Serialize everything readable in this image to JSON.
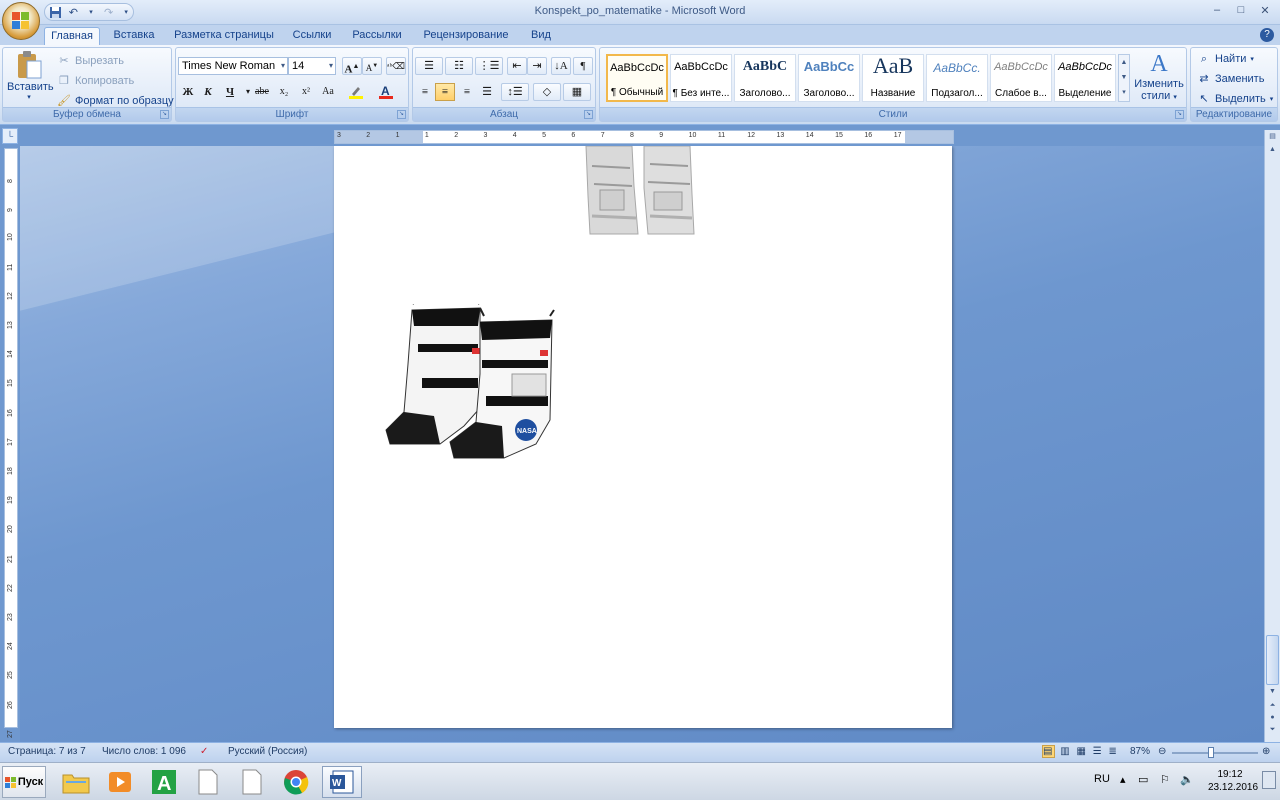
{
  "window": {
    "title": "Konspekt_po_matematike - Microsoft Word",
    "controls": [
      "–",
      "□",
      "✕"
    ]
  },
  "tabs": [
    "Главная",
    "Вставка",
    "Разметка страницы",
    "Ссылки",
    "Рассылки",
    "Рецензирование",
    "Вид"
  ],
  "clipboard": {
    "paste_label": "Вставить",
    "cut_label": "Вырезать",
    "copy_label": "Копировать",
    "format_painter_label": "Формат по образцу",
    "group_label": "Буфер обмена"
  },
  "font": {
    "font_name": "Times New Roman",
    "font_size": "14",
    "group_label": "Шрифт",
    "bold": "Ж",
    "italic": "К",
    "underline": "Ч",
    "strike": "abe",
    "subscript": "x₂",
    "superscript": "x²",
    "change_case": "Aa",
    "grow": "A",
    "shrink": "A"
  },
  "paragraph": {
    "group_label": "Абзац"
  },
  "styles": {
    "group_label": "Стили",
    "tiles": [
      {
        "sample": "AaBbCcDc",
        "name": "¶ Обычный"
      },
      {
        "sample": "AaBbCcDc",
        "name": "¶ Без инте..."
      },
      {
        "sample": "AaBbC",
        "name": "Заголово..."
      },
      {
        "sample": "AaBbCc",
        "name": "Заголово..."
      },
      {
        "sample": "AaB",
        "name": "Название"
      },
      {
        "sample": "AaBbCc.",
        "name": "Подзагол..."
      },
      {
        "sample": "AaBbCcDc",
        "name": "Слабое в..."
      },
      {
        "sample": "AaBbCcDc",
        "name": "Выделение"
      }
    ],
    "change_styles_label_1": "Изменить",
    "change_styles_label_2": "стили"
  },
  "editing": {
    "group_label": "Редактирование",
    "find_label": "Найти",
    "replace_label": "Заменить",
    "select_label": "Выделить"
  },
  "ruler": {
    "h_ticks": [
      "3",
      "2",
      "1",
      "1",
      "2",
      "3",
      "4",
      "5",
      "6",
      "7",
      "8",
      "9",
      "10",
      "11",
      "12",
      "13",
      "14",
      "15",
      "16",
      "17"
    ],
    "v_ticks": [
      "8",
      "9",
      "10",
      "11",
      "12",
      "13",
      "14",
      "15",
      "16",
      "17",
      "18",
      "19",
      "20",
      "21",
      "22",
      "23",
      "24",
      "25",
      "26",
      "27"
    ]
  },
  "status": {
    "page": "Страница: 7 из 7",
    "words": "Число слов: 1 096",
    "language": "Русский (Россия)",
    "zoom": "87%",
    "zoom_level": 0.45
  },
  "taskbar": {
    "start_label": "Пуск",
    "language": "RU",
    "time": "19:12",
    "date": "23.12.2016"
  }
}
